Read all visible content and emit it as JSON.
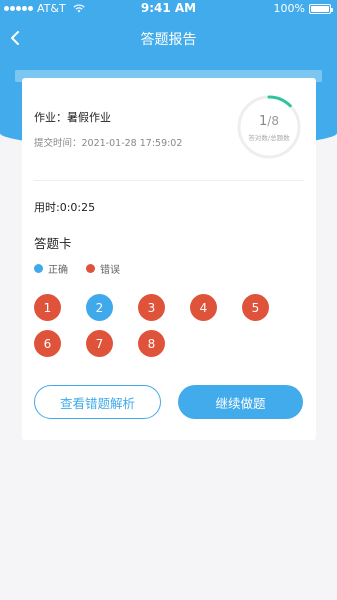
{
  "status_bar": {
    "carrier": "AT&T",
    "time": "9:41 AM",
    "battery": "100%"
  },
  "nav": {
    "title": "答题报告"
  },
  "homework": {
    "label": "作业：暑假作业",
    "submit_time": "提交时间：2021-01-28 17:59:02"
  },
  "summary": {
    "correct": "1",
    "total": "/8",
    "caption": "答对数/总题数",
    "progress": 0.125
  },
  "time_used": "用时:0:0:25",
  "answer_card": {
    "title": "答题卡",
    "legend": [
      {
        "label": "正确",
        "color": "#3fa9ec"
      },
      {
        "label": "错误",
        "color": "#e0533b"
      }
    ],
    "questions": [
      {
        "num": "1",
        "status": "wrong"
      },
      {
        "num": "2",
        "status": "right"
      },
      {
        "num": "3",
        "status": "wrong"
      },
      {
        "num": "4",
        "status": "wrong"
      },
      {
        "num": "5",
        "status": "wrong"
      },
      {
        "num": "6",
        "status": "wrong"
      },
      {
        "num": "7",
        "status": "wrong"
      },
      {
        "num": "8",
        "status": "wrong"
      }
    ]
  },
  "buttons": {
    "review": "查看错题解析",
    "continue": "继续做题"
  },
  "colors": {
    "primary": "#42abeb",
    "correct": "#3fa9ec",
    "wrong": "#e0533b",
    "ring_progress": "#2ec4a0"
  }
}
